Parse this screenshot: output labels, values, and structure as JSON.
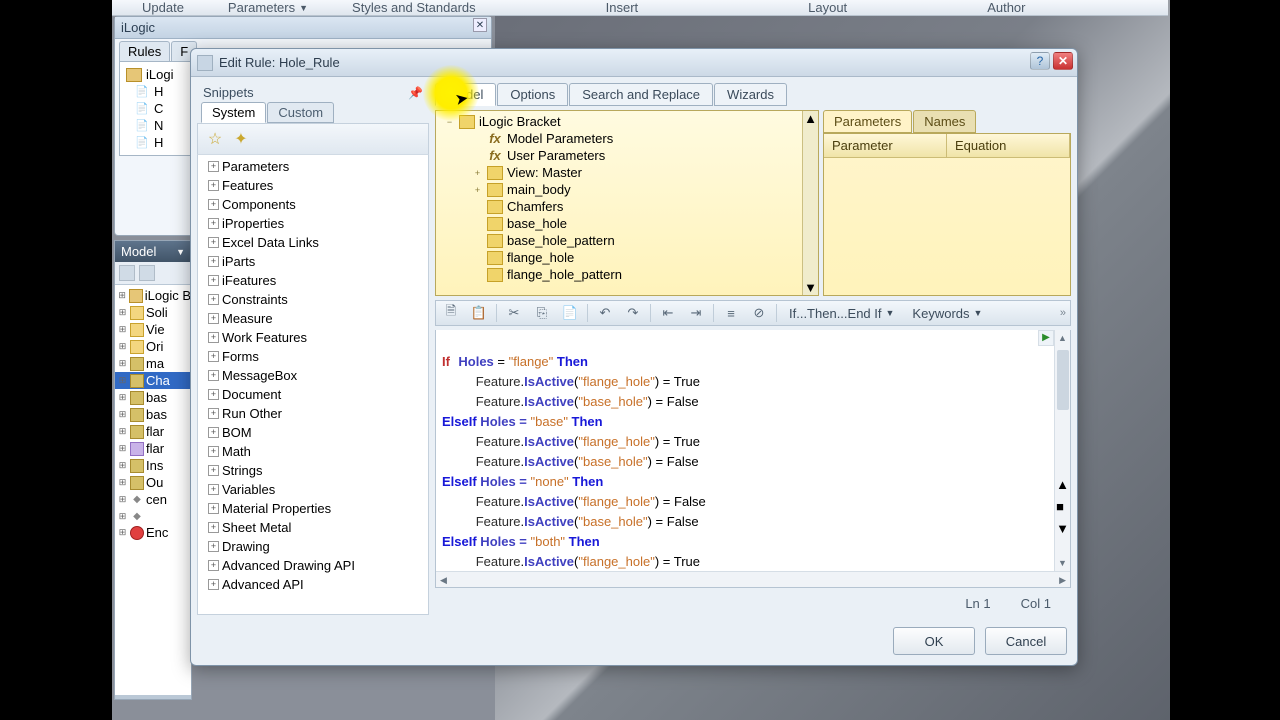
{
  "ribbon": {
    "tabs": [
      "Update",
      "Parameters",
      "Styles and Standards",
      "Insert",
      "Layout",
      "Author"
    ]
  },
  "ilogic_panel": {
    "title": "iLogic",
    "tabs": [
      "Rules",
      "F"
    ],
    "root": "iLogi",
    "items": [
      "H",
      "C",
      "N",
      "H"
    ]
  },
  "model_panel": {
    "title": "Model",
    "items": [
      {
        "label": "iLogic B",
        "icon": "box"
      },
      {
        "label": "Soli",
        "icon": "folder"
      },
      {
        "label": "Vie",
        "icon": "folder"
      },
      {
        "label": "Ori",
        "icon": "folder"
      },
      {
        "label": "ma",
        "icon": "cyl"
      },
      {
        "label": "Cha",
        "icon": "cyl",
        "sel": true
      },
      {
        "label": "bas",
        "icon": "cyl"
      },
      {
        "label": "bas",
        "icon": "cyl"
      },
      {
        "label": "flar",
        "icon": "cyl"
      },
      {
        "label": "flar",
        "icon": "purple"
      },
      {
        "label": "Ins",
        "icon": "cyl"
      },
      {
        "label": "Ou",
        "icon": "cyl"
      },
      {
        "label": "cen",
        "icon": "marker"
      },
      {
        "label": "",
        "icon": "marker"
      },
      {
        "label": "Enc",
        "icon": "red"
      }
    ]
  },
  "dialog": {
    "title": "Edit Rule: Hole_Rule",
    "snippets": {
      "title": "Snippets",
      "tabs": [
        "System",
        "Custom"
      ],
      "items": [
        "Parameters",
        "Features",
        "Components",
        "iProperties",
        "Excel Data Links",
        "iParts",
        "iFeatures",
        "Constraints",
        "Measure",
        "Work Features",
        "Forms",
        "MessageBox",
        "Document",
        "Run Other",
        "BOM",
        "Math",
        "Strings",
        "Variables",
        "Material Properties",
        "Sheet Metal",
        "Drawing",
        "Advanced Drawing API",
        "Advanced API"
      ]
    },
    "main_tabs": [
      "Model",
      "Options",
      "Search and Replace",
      "Wizards"
    ],
    "model_tree": {
      "root": "iLogic Bracket",
      "items": [
        {
          "label": "Model Parameters",
          "level": 1,
          "icon": "fx"
        },
        {
          "label": "User Parameters",
          "level": 1,
          "icon": "fx"
        },
        {
          "label": "View: Master",
          "level": 1,
          "icon": "view",
          "exp": "+"
        },
        {
          "label": "main_body",
          "level": 1,
          "icon": "part",
          "exp": "+"
        },
        {
          "label": "Chamfers",
          "level": 1,
          "icon": "part"
        },
        {
          "label": "base_hole",
          "level": 1,
          "icon": "part"
        },
        {
          "label": "base_hole_pattern",
          "level": 1,
          "icon": "part"
        },
        {
          "label": "flange_hole",
          "level": 1,
          "icon": "part"
        },
        {
          "label": "flange_hole_pattern",
          "level": 1,
          "icon": "part"
        }
      ]
    },
    "params": {
      "tabs": [
        "Parameters",
        "Names"
      ],
      "col1": "Parameter",
      "col2": "Equation"
    },
    "toolbar": {
      "ifthen": "If...Then...End If",
      "keywords": "Keywords"
    },
    "code": {
      "l1a": "If",
      "l1b": "Holes",
      "l1c": " = ",
      "l1d": "\"flange\"",
      "l1e": " Then",
      "l2a": "Feature",
      "l2b": ".",
      "l2c": "IsActive",
      "l2d": "(",
      "l2e": "\"flange_hole\"",
      "l2f": ") = ",
      "l2g": "True",
      "l3a": "Feature",
      "l3b": ".",
      "l3c": "IsActive",
      "l3d": "(",
      "l3e": "\"base_hole\"",
      "l3f": ") = ",
      "l3g": "False",
      "l4a": "ElseIf",
      "l4b": " Holes = ",
      "l4c": "\"base\"",
      "l4d": " Then",
      "l5a": "Feature",
      "l5b": ".",
      "l5c": "IsActive",
      "l5d": "(",
      "l5e": "\"flange_hole\"",
      "l5f": ") = ",
      "l5g": "True",
      "l6a": "Feature",
      "l6b": ".",
      "l6c": "IsActive",
      "l6d": "(",
      "l6e": "\"base_hole\"",
      "l6f": ") = ",
      "l6g": "False",
      "l7a": "ElseIf",
      "l7b": " Holes = ",
      "l7c": "\"none\"",
      "l7d": " Then",
      "l8a": "Feature",
      "l8b": ".",
      "l8c": "IsActive",
      "l8d": "(",
      "l8e": "\"flange_hole\"",
      "l8f": ") = ",
      "l8g": "False",
      "l9a": "Feature",
      "l9b": ".",
      "l9c": "IsActive",
      "l9d": "(",
      "l9e": "\"base_hole\"",
      "l9f": ") = ",
      "l9g": "False",
      "l10a": "ElseIf",
      "l10b": " Holes = ",
      "l10c": "\"both\"",
      "l10d": " Then",
      "l11a": "Feature",
      "l11b": ".",
      "l11c": "IsActive",
      "l11d": "(",
      "l11e": "\"flange_hole\"",
      "l11f": ") = ",
      "l11g": "True"
    },
    "status": {
      "ln": "Ln 1",
      "col": "Col 1"
    },
    "buttons": {
      "ok": "OK",
      "cancel": "Cancel"
    }
  }
}
